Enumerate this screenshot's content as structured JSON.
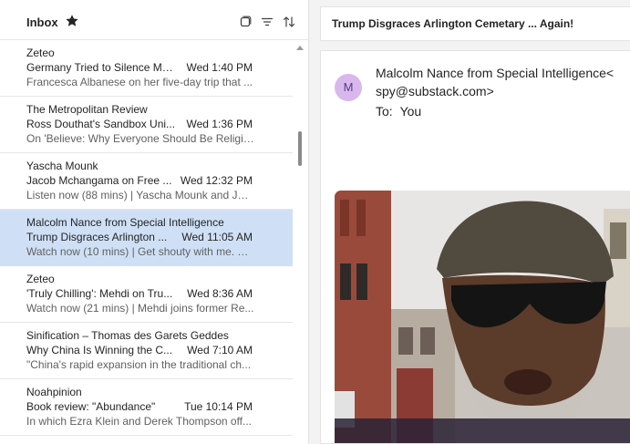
{
  "inbox": {
    "title": "Inbox",
    "icons": [
      "star-icon",
      "select-mode-icon",
      "filter-icon",
      "sort-icon"
    ]
  },
  "messages": [
    {
      "sender": "Zeteo",
      "subject": "Germany Tried to Silence Me...",
      "time": "Wed 1:40 PM",
      "preview": "Francesca Albanese on her five-day trip that ..."
    },
    {
      "sender": "The Metropolitan Review",
      "subject": "Ross Douthat's Sandbox Uni...",
      "time": "Wed 1:36 PM",
      "preview": "On 'Believe: Why Everyone Should Be Religio..."
    },
    {
      "sender": "Yascha Mounk",
      "subject": "Jacob Mchangama on Free ...",
      "time": "Wed 12:32 PM",
      "preview": "Listen now (88 mins) | Yascha Mounk and Jac..."
    },
    {
      "sender": "Malcolm Nance from Special Intelligence",
      "subject": "Trump Disgraces Arlington ...",
      "time": "Wed 11:05 AM",
      "preview": "Watch now (10 mins) | Get shouty with me. Tr...",
      "selected": true
    },
    {
      "sender": "Zeteo",
      "subject": "'Truly Chilling': Mehdi on Tru...",
      "time": "Wed 8:36 AM",
      "preview": "Watch now (21 mins) | Mehdi joins former Re..."
    },
    {
      "sender": "Sinification – Thomas des Garets Geddes",
      "subject": "Why China Is Winning the C...",
      "time": "Wed 7:10 AM",
      "preview": "\"China's rapid expansion in the traditional ch..."
    },
    {
      "sender": "Noahpinion",
      "subject": "Book review: \"Abundance\"",
      "time": "Tue 10:14 PM",
      "preview": "In which Ezra Klein and Derek Thompson off..."
    }
  ],
  "reading": {
    "title": "Trump Disgraces Arlington Cemetary ... Again!",
    "avatar_letter": "M",
    "from_line1": "Malcolm Nance from Special Intelligence<",
    "from_line2": "spy@substack.com>",
    "to_label": "To:",
    "to_value": "You"
  },
  "colors": {
    "selected_row": "#cfe0f6",
    "avatar_bg": "#d8b8ec"
  }
}
